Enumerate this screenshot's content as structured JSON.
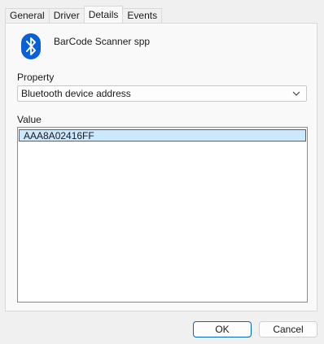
{
  "tabs": [
    {
      "label": "General"
    },
    {
      "label": "Driver"
    },
    {
      "label": "Details",
      "active": true
    },
    {
      "label": "Events"
    }
  ],
  "device": {
    "name": "BarCode Scanner spp",
    "icon": "bluetooth-icon",
    "icon_color": "#0a5fd6"
  },
  "property": {
    "label": "Property",
    "selected": "Bluetooth device address"
  },
  "value": {
    "label": "Value",
    "items": [
      "AAA8A02416FF"
    ]
  },
  "buttons": {
    "ok_label": "OK",
    "cancel_label": "Cancel"
  }
}
